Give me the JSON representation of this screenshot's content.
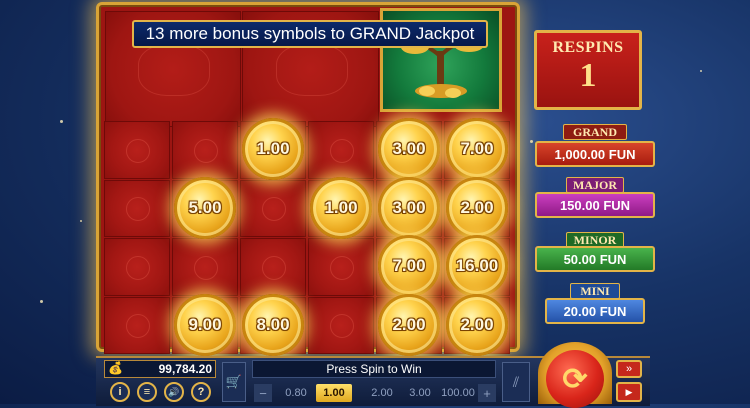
{
  "banner": {
    "text": "13 more bonus symbols to GRAND Jackpot"
  },
  "respins": {
    "title": "RESPINS",
    "count": "1"
  },
  "jackpots": [
    {
      "label": "GRAND",
      "value": "1,000.00 FUN",
      "color": "#c8311b"
    },
    {
      "label": "MAJOR",
      "value": "150.00 FUN",
      "color": "#b52aa8"
    },
    {
      "label": "MINOR",
      "value": "50.00 FUN",
      "color": "#2f9a38"
    },
    {
      "label": "MINI",
      "value": "20.00 FUN",
      "color": "#2f66c8"
    }
  ],
  "coins": [
    {
      "row": 1,
      "col": 3,
      "value": "1.00"
    },
    {
      "row": 1,
      "col": 5,
      "value": "3.00"
    },
    {
      "row": 1,
      "col": 6,
      "value": "7.00"
    },
    {
      "row": 2,
      "col": 2,
      "value": "5.00"
    },
    {
      "row": 2,
      "col": 4,
      "value": "1.00"
    },
    {
      "row": 2,
      "col": 5,
      "value": "3.00"
    },
    {
      "row": 2,
      "col": 6,
      "value": "2.00"
    },
    {
      "row": 3,
      "col": 5,
      "value": "7.00"
    },
    {
      "row": 3,
      "col": 6,
      "value": "16.00"
    },
    {
      "row": 4,
      "col": 2,
      "value": "9.00"
    },
    {
      "row": 4,
      "col": 3,
      "value": "8.00"
    },
    {
      "row": 4,
      "col": 5,
      "value": "2.00"
    },
    {
      "row": 4,
      "col": 6,
      "value": "2.00"
    }
  ],
  "balance": {
    "value": "99,784.20"
  },
  "status": {
    "message": "Press Spin to Win"
  },
  "bets": {
    "options": [
      "0.80",
      "1.00",
      "2.00",
      "3.00",
      "100.00"
    ],
    "selected": "1.00"
  },
  "buttons": {
    "info": "i",
    "menu": "≡",
    "sound": "🔊",
    "help": "?",
    "autoplay": "»"
  }
}
